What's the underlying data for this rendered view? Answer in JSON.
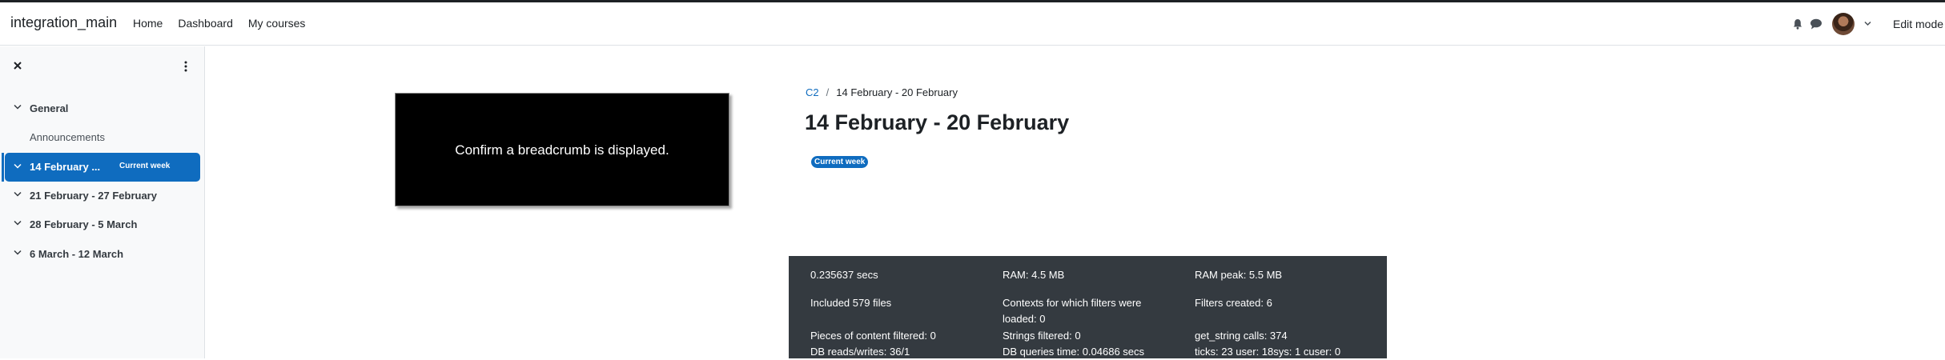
{
  "site": {
    "name": "integration_main"
  },
  "primary_nav": {
    "items": [
      "Home",
      "Dashboard",
      "My courses"
    ]
  },
  "user_menu": {
    "edit_mode_label": "Edit mode"
  },
  "course_index": {
    "sections": [
      {
        "title": "General",
        "activities": [
          "Announcements"
        ]
      },
      {
        "title": "14 February ...",
        "badge": "Current week",
        "active": true
      },
      {
        "title": "21 February - 27 February"
      },
      {
        "title": "28 February - 5 March"
      },
      {
        "title": "6 March - 12 March"
      }
    ]
  },
  "overlay": {
    "message": "Confirm a breadcrumb is displayed."
  },
  "breadcrumb": {
    "course": "C2",
    "current": "14 February - 20 February"
  },
  "page": {
    "title": "14 February - 20 February",
    "badge": "Current week"
  },
  "perf": {
    "time": "0.235637 secs",
    "ram": "RAM: 4.5 MB",
    "ram_peak": "RAM peak: 5.5 MB",
    "files": "Included 579 files",
    "contexts": "Contexts for which filters were loaded: 0",
    "filters_created": "Filters created: 6",
    "content_filtered": "Pieces of content filtered: 0",
    "strings_filtered": "Strings filtered: 0",
    "get_string": "get_string calls: 374",
    "db_rw": "DB reads/writes: 36/1",
    "db_time": "DB queries time: 0.04686 secs",
    "ticks": "ticks: 23 user: 18sys: 1 cuser: 0"
  },
  "colors": {
    "brand_blue": "#0f6cbf",
    "footer_bg": "#343a40",
    "drawer_bg": "#f8f9fa"
  },
  "icons": [
    "bell-icon",
    "chat-icon",
    "avatar",
    "chevron-down-icon",
    "close-icon",
    "kebab-icon"
  ]
}
